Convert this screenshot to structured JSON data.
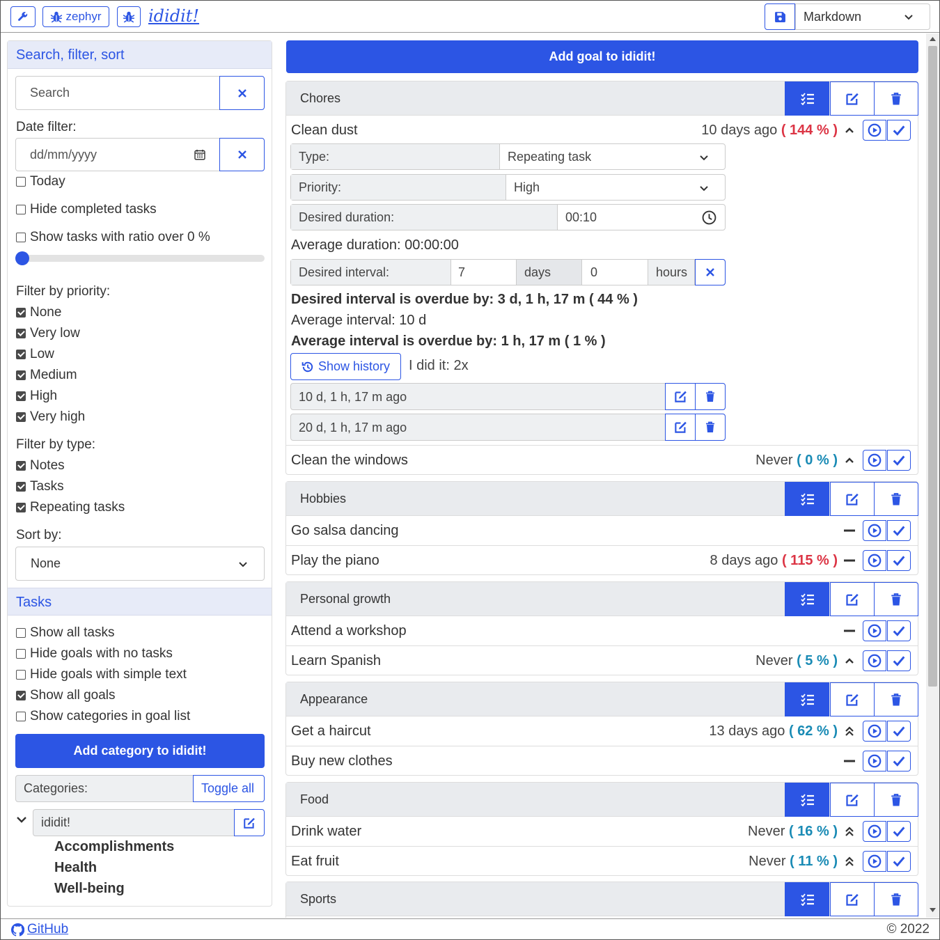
{
  "topbar": {
    "buttons": [
      {
        "name": "wrench-icon"
      },
      {
        "label": "zephyr",
        "icon": "bug-icon"
      },
      {
        "icon": "bug-icon"
      }
    ],
    "brand": "ididit!",
    "format": "Markdown"
  },
  "left": {
    "header": "Search, filter, sort",
    "search_placeholder": "Search",
    "date_filter_label": "Date filter:",
    "date_placeholder": "dd/mm/yyyy",
    "today": "Today",
    "hide_completed": "Hide completed tasks",
    "ratio_filter": "Show tasks with ratio over 0 %",
    "ratio_slider_value": 0,
    "priority_label": "Filter by priority:",
    "priorities": [
      "None",
      "Very low",
      "Low",
      "Medium",
      "High",
      "Very high"
    ],
    "type_label": "Filter by type:",
    "types": [
      "Notes",
      "Tasks",
      "Repeating tasks"
    ],
    "sort_label": "Sort by:",
    "sort_value": "None",
    "tasks_header": "Tasks",
    "task_options": [
      {
        "label": "Show all tasks",
        "checked": false
      },
      {
        "label": "Hide goals with no tasks",
        "checked": false
      },
      {
        "label": "Hide goals with simple text",
        "checked": false
      },
      {
        "label": "Show all goals",
        "checked": true
      },
      {
        "label": "Show categories in goal list",
        "checked": false
      }
    ],
    "add_category": "Add category to ididit!",
    "categories_label": "Categories:",
    "toggle_all": "Toggle all",
    "root_category": "ididit!",
    "subcategories": [
      "Accomplishments",
      "Health",
      "Well-being"
    ]
  },
  "main": {
    "add_goal": "Add goal to ididit!",
    "chores": {
      "title": "Chores",
      "clean_dust": {
        "name": "Clean dust",
        "last": "10 days ago",
        "pct": "( 144 % )",
        "type_label": "Type:",
        "type_value": "Repeating task",
        "priority_label": "Priority:",
        "priority_value": "High",
        "desired_duration_label": "Desired duration:",
        "desired_duration_value": "00:10",
        "average_duration": "Average duration: 00:00:00",
        "desired_interval_label": "Desired interval:",
        "interval_days": "7",
        "days_unit": "days",
        "interval_hours": "0",
        "hours_unit": "hours",
        "overdue1": "Desired interval is overdue by: 3 d, 1 h, 17 m ( 44 % )",
        "avg_interval": "Average interval: 10 d",
        "overdue2": "Average interval is overdue by: 1 h, 17 m ( 1 % )",
        "show_history": "Show history",
        "did_it": "I did it: 2x",
        "history": [
          "10 d, 1 h, 17 m ago",
          "20 d, 1 h, 17 m ago"
        ]
      },
      "windows": {
        "name": "Clean the windows",
        "last": "Never",
        "pct": "( 0 % )"
      }
    },
    "hobbies": {
      "title": "Hobbies",
      "salsa": {
        "name": "Go salsa dancing"
      },
      "piano": {
        "name": "Play the piano",
        "last": "8 days ago",
        "pct": "( 115 % )"
      }
    },
    "growth": {
      "title": "Personal growth",
      "workshop": {
        "name": "Attend a workshop"
      },
      "spanish": {
        "name": "Learn Spanish",
        "last": "Never",
        "pct": "( 5 % )"
      }
    },
    "appearance": {
      "title": "Appearance",
      "haircut": {
        "name": "Get a haircut",
        "last": "13 days ago",
        "pct": "( 62 % )"
      },
      "clothes": {
        "name": "Buy new clothes"
      }
    },
    "food": {
      "title": "Food",
      "water": {
        "name": "Drink water",
        "last": "Never",
        "pct": "( 16 % )"
      },
      "fruit": {
        "name": "Eat fruit",
        "last": "Never",
        "pct": "( 11 % )"
      }
    },
    "sports": {
      "title": "Sports"
    }
  },
  "footer": {
    "github": "GitHub",
    "copyright": "© 2022"
  },
  "colors": {
    "accent": "#2c55e4",
    "danger": "#dc3545",
    "info": "#1a8bb5"
  }
}
